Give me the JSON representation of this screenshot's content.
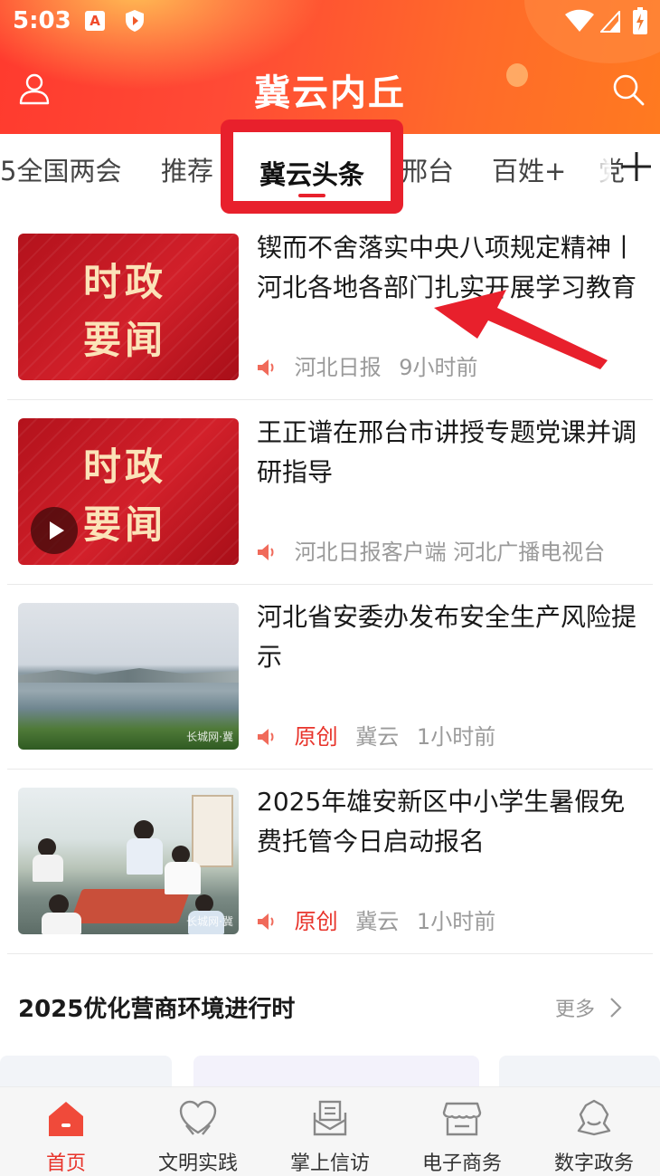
{
  "status_bar": {
    "time": "5:03",
    "a_badge": "A"
  },
  "header": {
    "title": "冀云内丘"
  },
  "tabs": {
    "items": [
      "5全国两会",
      "推荐",
      "冀云头条",
      "邢台",
      "百姓+",
      "党"
    ],
    "active": "冀云头条"
  },
  "news": [
    {
      "title": "锲而不舍落实中央八项规定精神丨河北各地各部门扎实开展学习教育",
      "thumb_text_1": "时政",
      "thumb_text_2": "要闻",
      "source": "河北日报",
      "time": "9小时前",
      "has_video": false,
      "original": ""
    },
    {
      "title": "王正谱在邢台市讲授专题党课并调研指导",
      "thumb_text_1": "时政",
      "thumb_text_2": "要闻",
      "source": "河北日报客户端 河北广播电视台",
      "time": "",
      "has_video": true,
      "original": ""
    },
    {
      "title": "河北省安委办发布安全生产风险提示",
      "source": "冀云",
      "time": "1小时前",
      "original": "原创",
      "watermark": "长城网·冀"
    },
    {
      "title": "2025年雄安新区中小学生暑假免费托管今日启动报名",
      "source": "冀云",
      "time": "1小时前",
      "original": "原创",
      "watermark": "长城网·冀"
    }
  ],
  "section": {
    "title": "2025优化营商环境进行时",
    "more": "更多"
  },
  "bottom_nav": [
    {
      "label": "首页",
      "icon": "home-icon",
      "active": true
    },
    {
      "label": "文明实践",
      "icon": "heart-hands-icon",
      "active": false
    },
    {
      "label": "掌上信访",
      "icon": "mail-icon",
      "active": false
    },
    {
      "label": "电子商务",
      "icon": "shop-icon",
      "active": false
    },
    {
      "label": "数字政务",
      "icon": "gov-icon",
      "active": false
    }
  ],
  "colors": {
    "accent": "#e8332a",
    "highlight_box": "#e8202c",
    "header_from": "#ff3a2e",
    "header_to": "#ff7a20"
  }
}
